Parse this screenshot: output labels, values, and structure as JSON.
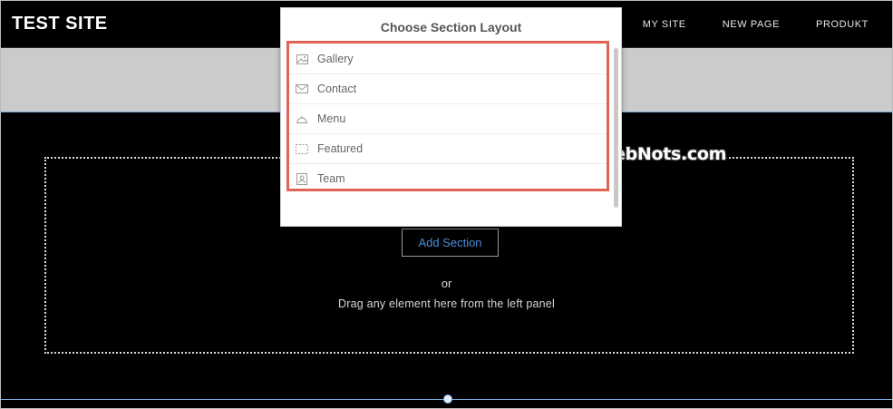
{
  "header": {
    "site_title": "TEST SITE",
    "nav": [
      "MY SITE",
      "NEW PAGE",
      "PRODUKT"
    ]
  },
  "section": {
    "add_section_label": "Add Section",
    "or_text": "or",
    "drag_text": "Drag any element here from the left panel"
  },
  "popup": {
    "title": "Choose Section Layout",
    "items": [
      {
        "label": "Gallery",
        "icon": "image-icon"
      },
      {
        "label": "Contact",
        "icon": "envelope-icon"
      },
      {
        "label": "Menu",
        "icon": "cloche-icon"
      },
      {
        "label": "Featured",
        "icon": "dashed-box-icon"
      },
      {
        "label": "Team",
        "icon": "person-card-icon"
      }
    ],
    "highlight_color": "#e06356"
  },
  "watermark": "WebNots.com",
  "colors": {
    "accent": "#4a8fe0",
    "guide_line": "#7aa9dc"
  }
}
